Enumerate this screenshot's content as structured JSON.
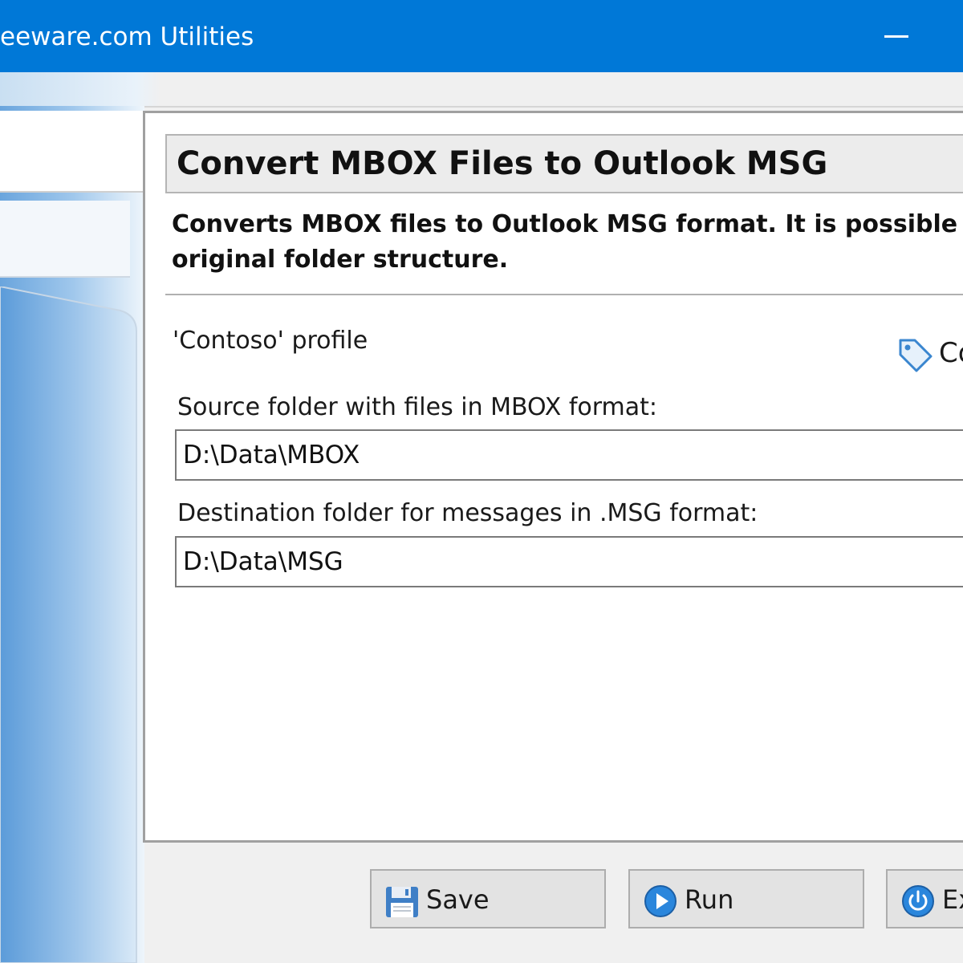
{
  "window": {
    "title": "eeware.com Utilities"
  },
  "task": {
    "title": "Convert MBOX Files to Outlook MSG",
    "description_line1": "Converts MBOX files to Outlook MSG format. It is possible to r",
    "description_line2": "original folder structure."
  },
  "profile": {
    "label": "'Contoso' profile",
    "link_text": "Co"
  },
  "fields": {
    "source_label": "Source folder with files in MBOX format:",
    "source_value": "D:\\Data\\MBOX",
    "destination_label": "Destination folder for messages in .MSG format:",
    "destination_value": "D:\\Data\\MSG"
  },
  "buttons": {
    "save_label": "Save",
    "run_label": "Run",
    "exit_label": "Ex"
  },
  "colors": {
    "titlebar": "#0078d7",
    "accent": "#1e7fd6"
  },
  "icons": {
    "minimize": "minimize-icon",
    "tag": "tag-icon",
    "save": "floppy-disk-icon",
    "run": "play-icon",
    "exit": "power-icon"
  }
}
